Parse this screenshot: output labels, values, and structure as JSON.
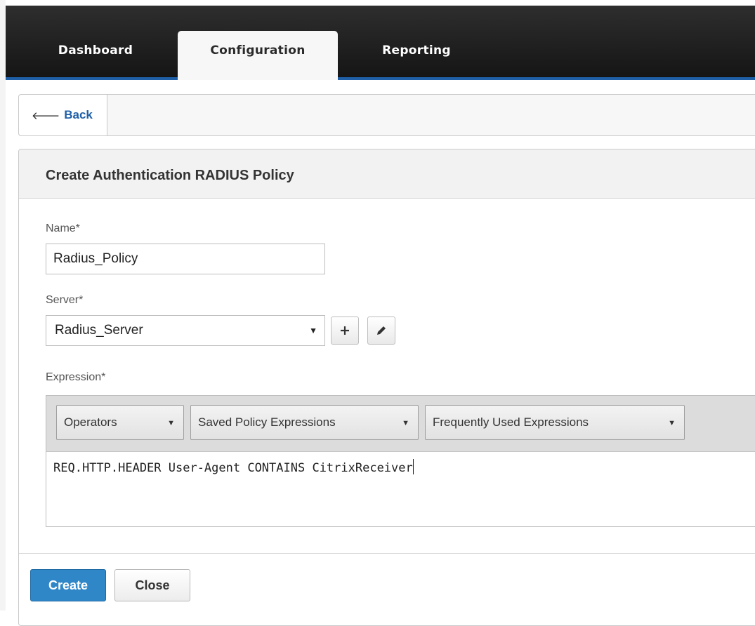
{
  "nav": {
    "tabs": [
      {
        "label": "Dashboard"
      },
      {
        "label": "Configuration"
      },
      {
        "label": "Reporting"
      }
    ],
    "active_tab": "Configuration"
  },
  "back": {
    "label": "Back",
    "icon": "arrow-left-icon"
  },
  "panel": {
    "title": "Create Authentication RADIUS Policy",
    "name": {
      "label": "Name*",
      "value": "Radius_Policy"
    },
    "server": {
      "label": "Server*",
      "value": "Radius_Server",
      "add_icon": "plus-icon",
      "edit_icon": "pencil-icon"
    },
    "expression": {
      "label": "Expression*",
      "dropdowns": [
        {
          "label": "Operators"
        },
        {
          "label": "Saved Policy Expressions"
        },
        {
          "label": "Frequently Used Expressions"
        }
      ],
      "value": "REQ.HTTP.HEADER User-Agent CONTAINS CitrixReceiver"
    }
  },
  "actions": {
    "create_label": "Create",
    "close_label": "Close"
  },
  "colors": {
    "accent": "#2f87c8",
    "nav_bg": "#1a1a1a",
    "nav_border": "#1f5fa8"
  }
}
